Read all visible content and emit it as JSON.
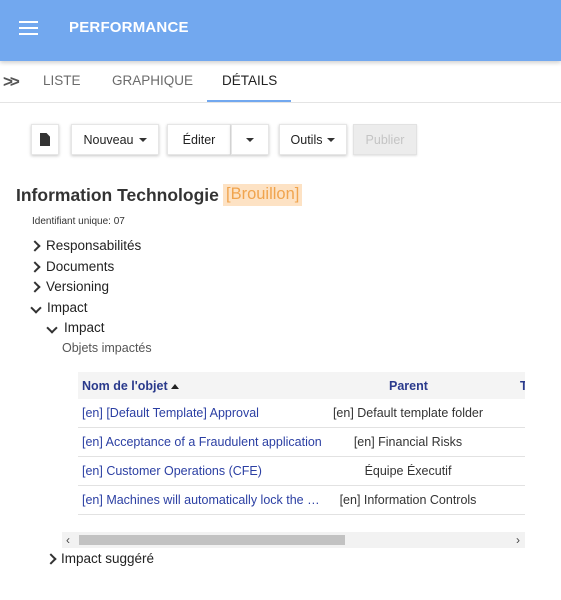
{
  "app": {
    "title": "PERFORMANCE"
  },
  "tabs": [
    {
      "label": "LISTE"
    },
    {
      "label": "GRAPHIQUE"
    },
    {
      "label": "DÉTAILS"
    }
  ],
  "toolbar": {
    "new_label": "Nouveau",
    "edit_label": "Éditer",
    "tools_label": "Outils",
    "publish_label": "Publier"
  },
  "page": {
    "title": "Information Technologie",
    "status": "[Brouillon]",
    "uid_label": "Identifiant unique:",
    "uid_value": "07"
  },
  "tree": {
    "responsabilites": "Responsabilités",
    "documents": "Documents",
    "versioning": "Versioning",
    "impact": "Impact",
    "impact_sub": "Impact",
    "impacted_objects": "Objets impactés",
    "suggested_impact": "Impact suggéré"
  },
  "grid": {
    "columns": [
      "Nom de l'objet",
      "Parent",
      "T"
    ],
    "rows": [
      {
        "name": "[en] [Default Template] Approval",
        "parent": "[en] Default template folder"
      },
      {
        "name": "[en] Acceptance of a Fraudulent application",
        "parent": "[en] Financial Risks"
      },
      {
        "name": "[en] Customer Operations (CFE)",
        "parent": "Équipe Éxecutif"
      },
      {
        "name": "[en] Machines will automatically lock the user",
        "parent": "[en] Information Controls"
      }
    ]
  },
  "icons": {
    "menu": "hamburger-icon",
    "expand": "double-chevron-right-icon",
    "document": "document-icon"
  },
  "colors": {
    "appbar": "#72a8ef",
    "link": "#2b3fa3",
    "status_bg": "#fde2c4",
    "status_text": "#f0a44e"
  }
}
